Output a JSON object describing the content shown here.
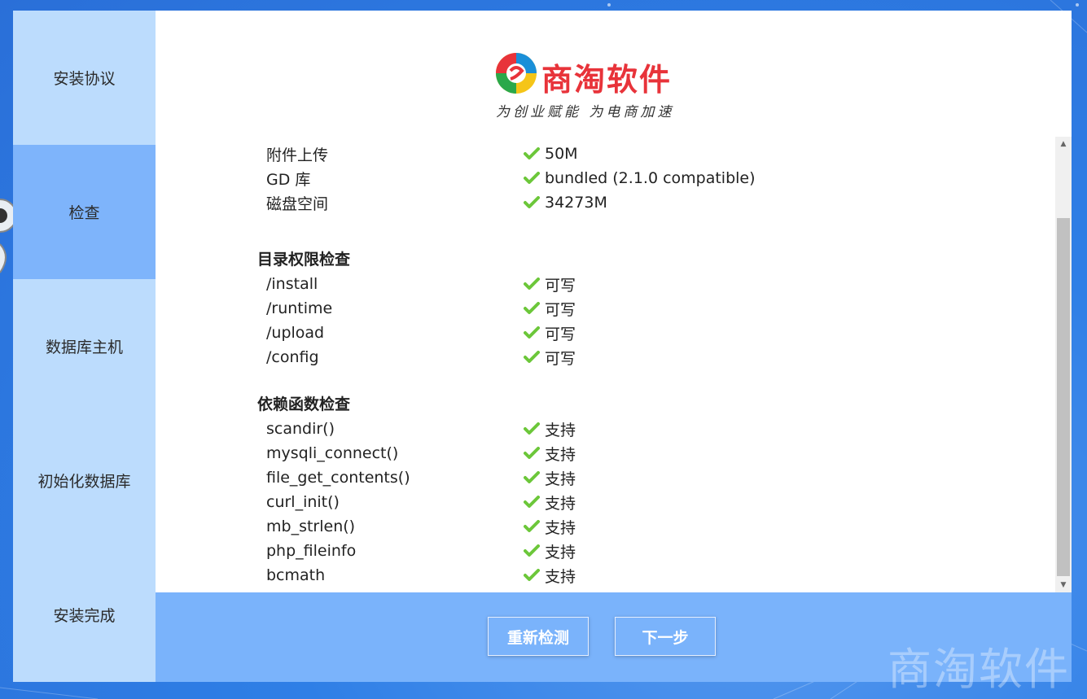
{
  "sidebar": {
    "steps": [
      {
        "label": "安装协议"
      },
      {
        "label": "检查"
      },
      {
        "label": "数据库主机"
      },
      {
        "label": "初始化数据库"
      },
      {
        "label": "安装完成"
      }
    ]
  },
  "logo": {
    "name": "商淘软件",
    "slogan": "为创业赋能 为电商加速"
  },
  "env_rows": [
    {
      "label": "附件上传",
      "value": "50M"
    },
    {
      "label": "GD 库",
      "value": "bundled (2.1.0 compatible)"
    },
    {
      "label": "磁盘空间",
      "value": "34273M"
    }
  ],
  "dir_section": {
    "title": "目录权限检查",
    "rows": [
      {
        "label": "/install",
        "value": "可写"
      },
      {
        "label": "/runtime",
        "value": "可写"
      },
      {
        "label": "/upload",
        "value": "可写"
      },
      {
        "label": "/config",
        "value": "可写"
      }
    ]
  },
  "func_section": {
    "title": "依赖函数检查",
    "rows": [
      {
        "label": "scandir()",
        "value": "支持"
      },
      {
        "label": "mysqli_connect()",
        "value": "支持"
      },
      {
        "label": "file_get_contents()",
        "value": "支持"
      },
      {
        "label": "curl_init()",
        "value": "支持"
      },
      {
        "label": "mb_strlen()",
        "value": "支持"
      },
      {
        "label": "php_fileinfo",
        "value": "支持"
      },
      {
        "label": "bcmath",
        "value": "支持"
      }
    ]
  },
  "footer": {
    "recheck_label": "重新检测",
    "next_label": "下一步"
  },
  "watermark": "商淘软件",
  "colors": {
    "accent": "#7ab3fb",
    "sidebar": "#bcdcfd",
    "check": "#6cc73a",
    "brand_red": "#e8333a"
  }
}
